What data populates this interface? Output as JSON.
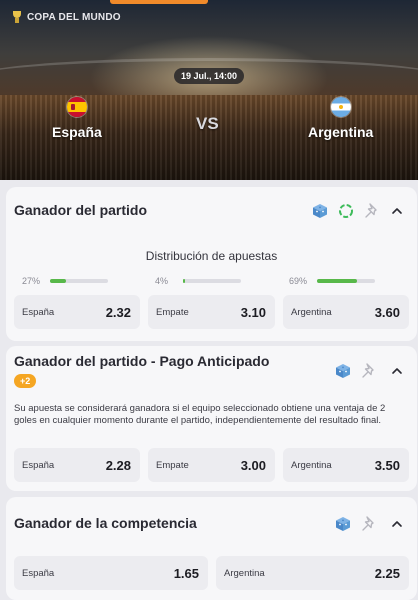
{
  "header": {
    "competition": "COPA DEL MUNDO",
    "datetime": "19 Jul., 14:00",
    "home_team": "España",
    "away_team": "Argentina",
    "vs": "VS",
    "accent_color": "#f08a2a"
  },
  "markets": [
    {
      "title": "Ganador del partido",
      "icons": [
        "bet-builder-icon",
        "live-circle-icon",
        "pin-icon",
        "chevron-up-icon"
      ],
      "distribution_title": "Distribución de apuestas",
      "distribution": [
        {
          "pct": "27%",
          "value": 0.27
        },
        {
          "pct": "4%",
          "value": 0.04
        },
        {
          "pct": "69%",
          "value": 0.69
        }
      ],
      "odds": [
        {
          "label": "España",
          "value": "2.32"
        },
        {
          "label": "Empate",
          "value": "3.10"
        },
        {
          "label": "Argentina",
          "value": "3.60"
        }
      ]
    },
    {
      "title": "Ganador del partido - Pago Anticipado",
      "badge": "+2",
      "icons": [
        "bet-builder-icon",
        "pin-icon",
        "chevron-up-icon"
      ],
      "description": "Su apuesta se considerará ganadora si el equipo seleccionado obtiene una ventaja de 2 goles en cualquier momento durante el partido, independientemente del resultado final.",
      "odds": [
        {
          "label": "España",
          "value": "2.28"
        },
        {
          "label": "Empate",
          "value": "3.00"
        },
        {
          "label": "Argentina",
          "value": "3.50"
        }
      ]
    },
    {
      "title": "Ganador de la competencia",
      "icons": [
        "bet-builder-icon",
        "pin-icon",
        "chevron-up-icon"
      ],
      "odds": [
        {
          "label": "España",
          "value": "1.65"
        },
        {
          "label": "Argentina",
          "value": "2.25"
        }
      ]
    }
  ],
  "colors": {
    "bar_fill": "#58b84a",
    "badge": "#f5a623",
    "icon_blue": "#5b9bd5",
    "live_green": "#3dbb5a"
  }
}
